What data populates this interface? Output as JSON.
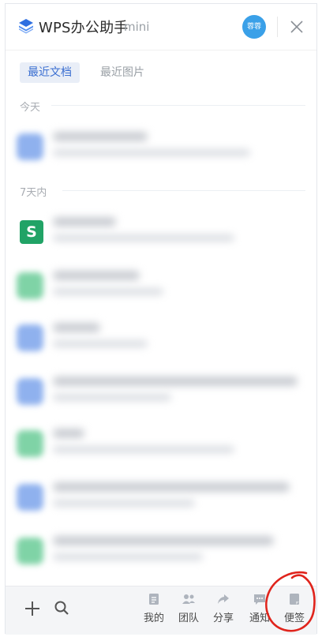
{
  "app": {
    "title": "WPS办公助手",
    "subtitle": "mini",
    "avatar_text": "蓉蓉"
  },
  "tabs": [
    {
      "label": "最近文档",
      "active": true
    },
    {
      "label": "最近图片",
      "active": false
    }
  ],
  "sections": {
    "today": "今天",
    "week": "7天内"
  },
  "footer": {
    "nav": [
      {
        "label": "我的",
        "icon": "doc-icon"
      },
      {
        "label": "团队",
        "icon": "team-icon"
      },
      {
        "label": "分享",
        "icon": "share-icon"
      },
      {
        "label": "通知",
        "icon": "message-icon"
      },
      {
        "label": "便签",
        "icon": "note-icon"
      }
    ]
  },
  "colors": {
    "accent": "#3b6fd1",
    "avatar": "#3aa0e8",
    "sheet_icon": "#21a366",
    "annotation": "#e0241c"
  }
}
